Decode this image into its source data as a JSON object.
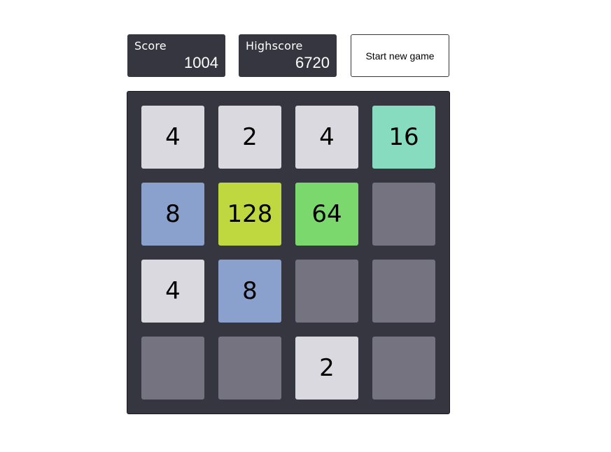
{
  "header": {
    "score_label": "Score",
    "score_value": "1004",
    "highscore_label": "Highscore",
    "highscore_value": "6720",
    "new_game_label": "Start new game"
  },
  "board": {
    "rows": [
      [
        {
          "value": "4",
          "color": "#d9d9df"
        },
        {
          "value": "2",
          "color": "#d9d9df"
        },
        {
          "value": "4",
          "color": "#d9d9df"
        },
        {
          "value": "16",
          "color": "#87dbbe"
        }
      ],
      [
        {
          "value": "8",
          "color": "#8aa0cd"
        },
        {
          "value": "128",
          "color": "#bfd83f"
        },
        {
          "value": "64",
          "color": "#7bd86c"
        },
        {
          "value": "",
          "color": "#75737f"
        }
      ],
      [
        {
          "value": "4",
          "color": "#d9d9df"
        },
        {
          "value": "8",
          "color": "#8aa0cd"
        },
        {
          "value": "",
          "color": "#75737f"
        },
        {
          "value": "",
          "color": "#75737f"
        }
      ],
      [
        {
          "value": "",
          "color": "#75737f"
        },
        {
          "value": "",
          "color": "#75737f"
        },
        {
          "value": "2",
          "color": "#d9d9df"
        },
        {
          "value": "",
          "color": "#75737f"
        }
      ]
    ]
  },
  "colors": {
    "panel": "#363640",
    "empty_cell": "#75737f"
  }
}
